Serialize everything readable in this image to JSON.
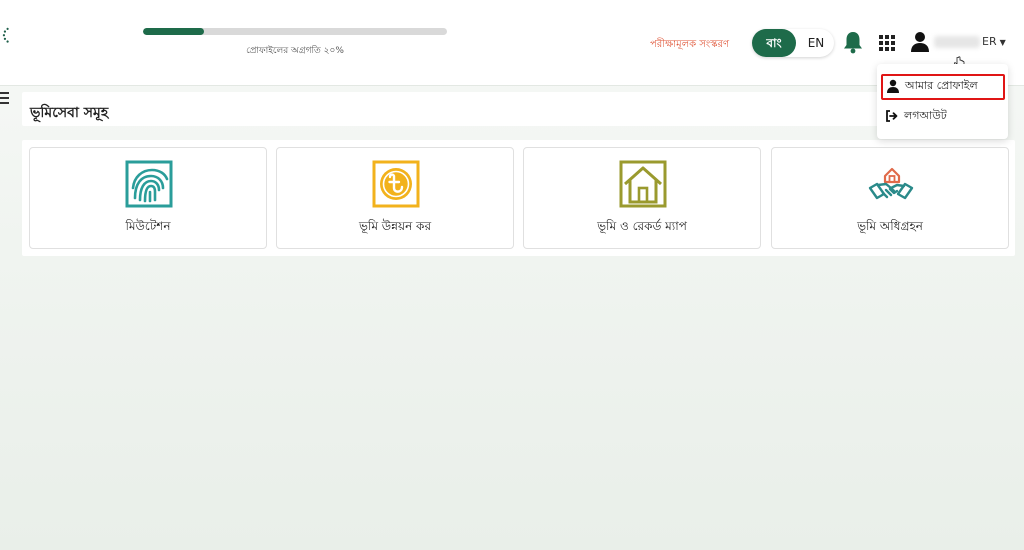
{
  "header": {
    "progress": {
      "value": 0.2,
      "label": "প্রোফাইলের অগ্রগতি ২০%"
    },
    "trial_label": "পরীক্ষামূলক সংস্করণ",
    "language": {
      "bn_label": "বাং",
      "en_label": "EN",
      "active": "bn"
    },
    "user": {
      "name_suffix": "ER"
    }
  },
  "section": {
    "title": "ভূমিসেবা সমূহ"
  },
  "services": [
    {
      "label": "মিউটেশন",
      "icon": "fingerprint-icon",
      "color": "#2a9d9a"
    },
    {
      "label": "ভূমি উন্নয়ন কর",
      "icon": "taka-coin-icon",
      "color": "#f2b21c"
    },
    {
      "label": "ভূমি ও রেকর্ড ম্যাপ",
      "icon": "house-icon",
      "color": "#9a9a2e"
    },
    {
      "label": "ভূমি অধিগ্রহন",
      "icon": "handshake-icon",
      "color": "#2a8a8a"
    }
  ],
  "user_menu": {
    "profile_label": "আমার প্রোফাইল",
    "logout_label": "লগআউট"
  },
  "colors": {
    "brand_green": "#1e6b4a",
    "trial_orange": "#e0573a",
    "highlight_red": "#e01515"
  }
}
